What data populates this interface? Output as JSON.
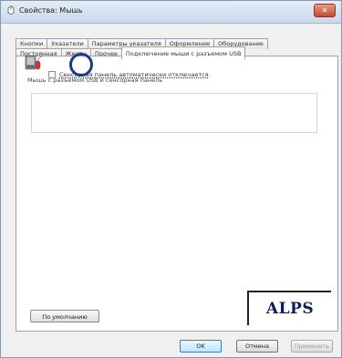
{
  "window": {
    "title": "Свойства: Мышь",
    "close_label": "✕"
  },
  "tabs_row1": [
    {
      "label": "Кнопки"
    },
    {
      "label": "Указатели"
    },
    {
      "label": "Параметры указателя"
    },
    {
      "label": "Оформление"
    },
    {
      "label": "Оборудование"
    }
  ],
  "tabs_row2": [
    {
      "label": "Постоянная"
    },
    {
      "label": "Жесты"
    },
    {
      "label": "Прочее"
    },
    {
      "label": "Подключение мыши с разъемом USB",
      "active": true
    }
  ],
  "panel": {
    "group_label": "Мышь с разъемом USB и сенсорная панель",
    "checkbox_label": "Сенсорная панель автоматически отключается",
    "checkbox_checked": false
  },
  "buttons": {
    "defaults": "По умолчанию",
    "ok": "OK",
    "cancel": "Отмена",
    "apply": "Применить"
  },
  "brand": {
    "logo_text": "ALPS"
  },
  "colors": {
    "annotation_circle": "#1c3a8a",
    "logo": "#0d1c5c"
  }
}
